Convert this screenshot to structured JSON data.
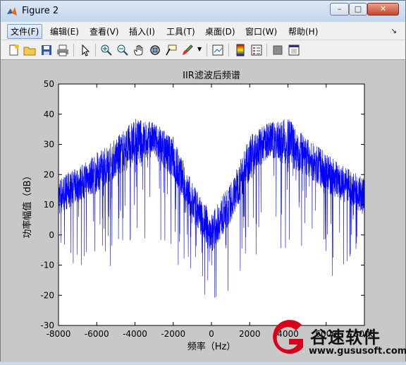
{
  "window": {
    "title": "Figure 2",
    "minimize": "–",
    "maximize": "□",
    "close": "✕"
  },
  "menu": [
    {
      "label": "文件(F)",
      "active": true
    },
    {
      "label": "编辑(E)"
    },
    {
      "label": "查看(V)"
    },
    {
      "label": "插入(I)"
    },
    {
      "label": "工具(T)"
    },
    {
      "label": "桌面(D)"
    },
    {
      "label": "窗口(W)"
    },
    {
      "label": "帮助(H)"
    }
  ],
  "toolbar": [
    "new-figure-icon",
    "open-file-icon",
    "save-icon",
    "print-icon",
    "select-arrow-icon",
    "zoom-in-icon",
    "zoom-out-icon",
    "pan-hand-icon",
    "rotate-3d-icon",
    "data-cursor-icon",
    "brush-icon",
    "link-plot-icon",
    "colorbar-icon",
    "legend-icon",
    "hide-plot-tools-icon",
    "show-plot-tools-icon"
  ],
  "chart_data": {
    "type": "line",
    "title": "IIR滤波后频谱",
    "xlabel": "频率（Hz）",
    "ylabel": "功率幅值（dB）",
    "xlim": [
      -8000,
      8000
    ],
    "ylim": [
      -30,
      50
    ],
    "xticks": [
      -8000,
      -6000,
      -4000,
      -2000,
      0,
      2000,
      4000,
      6000,
      8000
    ],
    "yticks": [
      -30,
      -20,
      -10,
      0,
      10,
      20,
      30,
      40,
      50
    ],
    "grid": false,
    "series": [
      {
        "color": "#0000ff",
        "envelope_x": [
          -8000,
          -7000,
          -6000,
          -5000,
          -4000,
          -3000,
          -2000,
          -1000,
          0,
          1000,
          2000,
          3000,
          4000,
          5000,
          6000,
          7000,
          8000
        ],
        "mean_db": [
          12,
          16,
          20,
          25,
          30,
          31,
          25,
          10,
          0,
          10,
          25,
          31,
          30,
          25,
          20,
          16,
          12
        ],
        "peak_db": [
          22,
          25,
          30,
          35,
          42,
          40,
          36,
          20,
          10,
          20,
          36,
          40,
          42,
          35,
          30,
          25,
          22
        ],
        "trough_db": [
          -8,
          -10,
          -16,
          -10,
          -5,
          -5,
          -10,
          -20,
          -22,
          -20,
          -10,
          -5,
          -5,
          -10,
          -16,
          -10,
          -8
        ]
      }
    ]
  },
  "watermark": {
    "text": "谷速软件",
    "url": "www.gususoft.com",
    "color": "#d9001b"
  }
}
